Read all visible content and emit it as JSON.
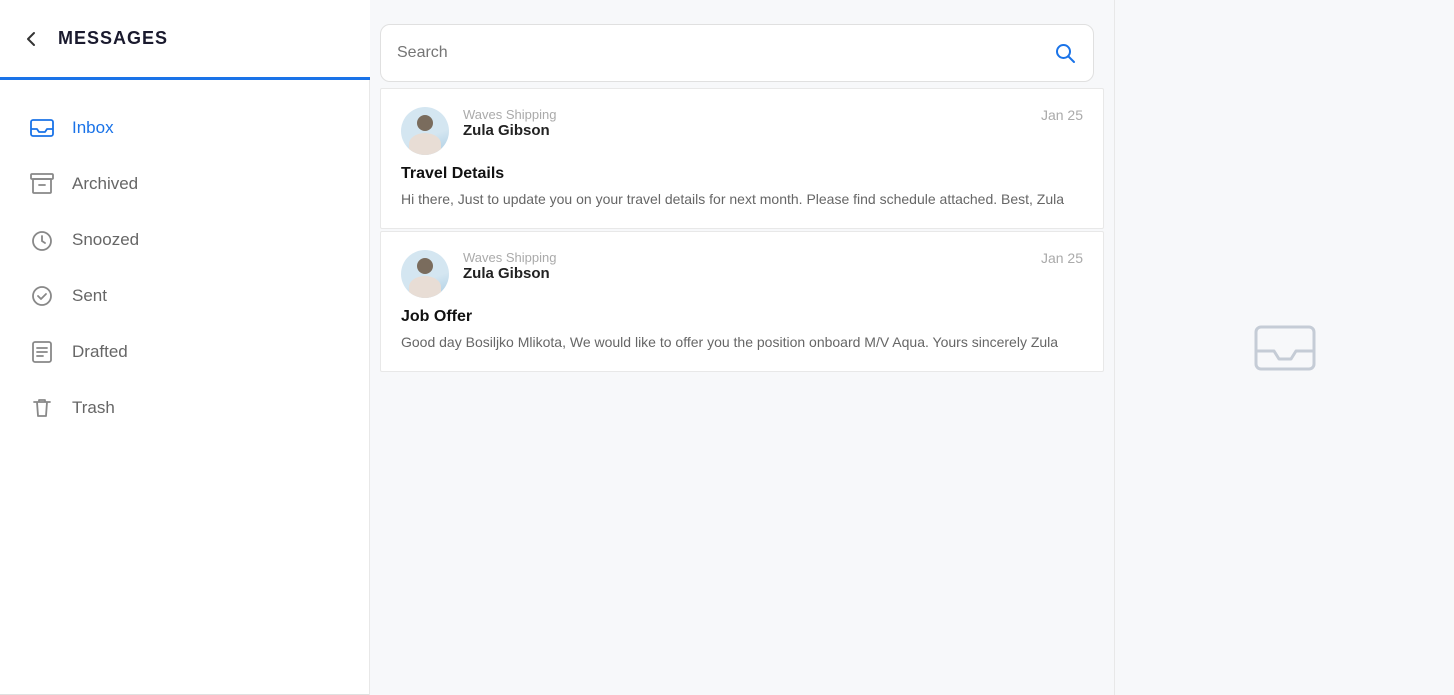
{
  "header": {
    "back_label": "←",
    "title": "MESSAGES",
    "active_underline_color": "#1a73e8"
  },
  "search": {
    "placeholder": "Search"
  },
  "sidebar": {
    "items": [
      {
        "id": "inbox",
        "label": "Inbox",
        "active": true
      },
      {
        "id": "archived",
        "label": "Archived",
        "active": false
      },
      {
        "id": "snoozed",
        "label": "Snoozed",
        "active": false
      },
      {
        "id": "sent",
        "label": "Sent",
        "active": false
      },
      {
        "id": "drafted",
        "label": "Drafted",
        "active": false
      },
      {
        "id": "trash",
        "label": "Trash",
        "active": false
      }
    ]
  },
  "messages": [
    {
      "id": 1,
      "company": "Waves Shipping",
      "sender": "Zula Gibson",
      "date": "Jan 25",
      "subject": "Travel Details",
      "preview": "Hi there, Just to update you on your travel details for next month. Please find schedule attached. Best, Zula"
    },
    {
      "id": 2,
      "company": "Waves Shipping",
      "sender": "Zula Gibson",
      "date": "Jan 25",
      "subject": "Job Offer",
      "preview": "Good day Bosiljko Mlikota, We would like to offer you the position onboard M/V Aqua. Yours sincerely Zula"
    }
  ]
}
